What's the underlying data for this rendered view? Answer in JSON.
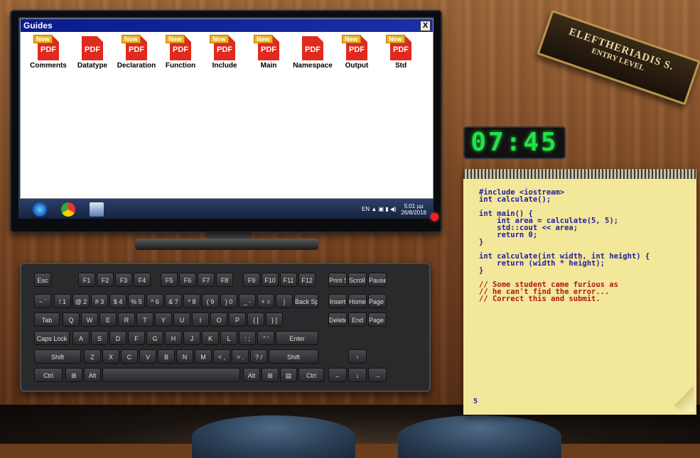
{
  "window": {
    "title": "Guides",
    "close_label": "X"
  },
  "files": [
    {
      "name": "Comments",
      "badge": "New",
      "type": "PDF"
    },
    {
      "name": "Datatype",
      "badge": "",
      "type": "PDF"
    },
    {
      "name": "Declaration",
      "badge": "New",
      "type": "PDF"
    },
    {
      "name": "Function",
      "badge": "New",
      "type": "PDF"
    },
    {
      "name": "Include",
      "badge": "New",
      "type": "PDF"
    },
    {
      "name": "Main",
      "badge": "New",
      "type": "PDF"
    },
    {
      "name": "Namespace",
      "badge": "",
      "type": "PDF"
    },
    {
      "name": "Output",
      "badge": "New",
      "type": "PDF"
    },
    {
      "name": "Std",
      "badge": "New",
      "type": "PDF"
    }
  ],
  "taskbar": {
    "lang": "EN",
    "time": "5:01 μμ",
    "date": "26/8/2018"
  },
  "nameplate": {
    "name": "ELEFTHERIADIS S.",
    "level": "ENTRY LEVEL"
  },
  "clock": {
    "time": "07:45"
  },
  "notepad": {
    "code_lines": [
      "#include <iostream>",
      "int calculate();",
      "",
      "int main() {",
      "    int area = calculate(5, 5);",
      "    std::cout << area;",
      "    return 0;",
      "}",
      "",
      "int calculate(int width, int height) {",
      "    return (width * height);",
      "}"
    ],
    "comment_lines": [
      "// Some student came furious as",
      "// he can't find the error...",
      "// Correct this and submit."
    ],
    "line_number": "5"
  },
  "keyboard": {
    "rows": [
      [
        "Esc",
        "F1",
        "F2",
        "F3",
        "F4",
        "F5",
        "F6",
        "F7",
        "F8",
        "F9",
        "F10",
        "F11",
        "F12",
        "Print Screen",
        "Scroll Lock",
        "Pause Break"
      ],
      [
        "~ `",
        "! 1",
        "@ 2",
        "# 3",
        "$ 4",
        "% 5",
        "^ 6",
        "& 7",
        "* 8",
        "( 9",
        ") 0",
        "_ -",
        "+ =",
        "|",
        "Back Space",
        "Insert",
        "Home",
        "Page Up"
      ],
      [
        "Tab",
        "Q",
        "W",
        "E",
        "R",
        "T",
        "Y",
        "U",
        "I",
        "O",
        "P",
        "{ [",
        "} ]",
        "Delete",
        "End",
        "Page Down"
      ],
      [
        "Caps Lock",
        "A",
        "S",
        "D",
        "F",
        "G",
        "H",
        "J",
        "K",
        "L",
        ": ;",
        "\" '",
        "Enter"
      ],
      [
        "Shift",
        "Z",
        "X",
        "C",
        "V",
        "B",
        "N",
        "M",
        "< ,",
        "> .",
        "? /",
        "Shift",
        "↑"
      ],
      [
        "Ctrl",
        "⊞",
        "Alt",
        "",
        "Alt",
        "⊞",
        "▤",
        "Ctrl",
        "←",
        "↓",
        "→"
      ]
    ]
  }
}
